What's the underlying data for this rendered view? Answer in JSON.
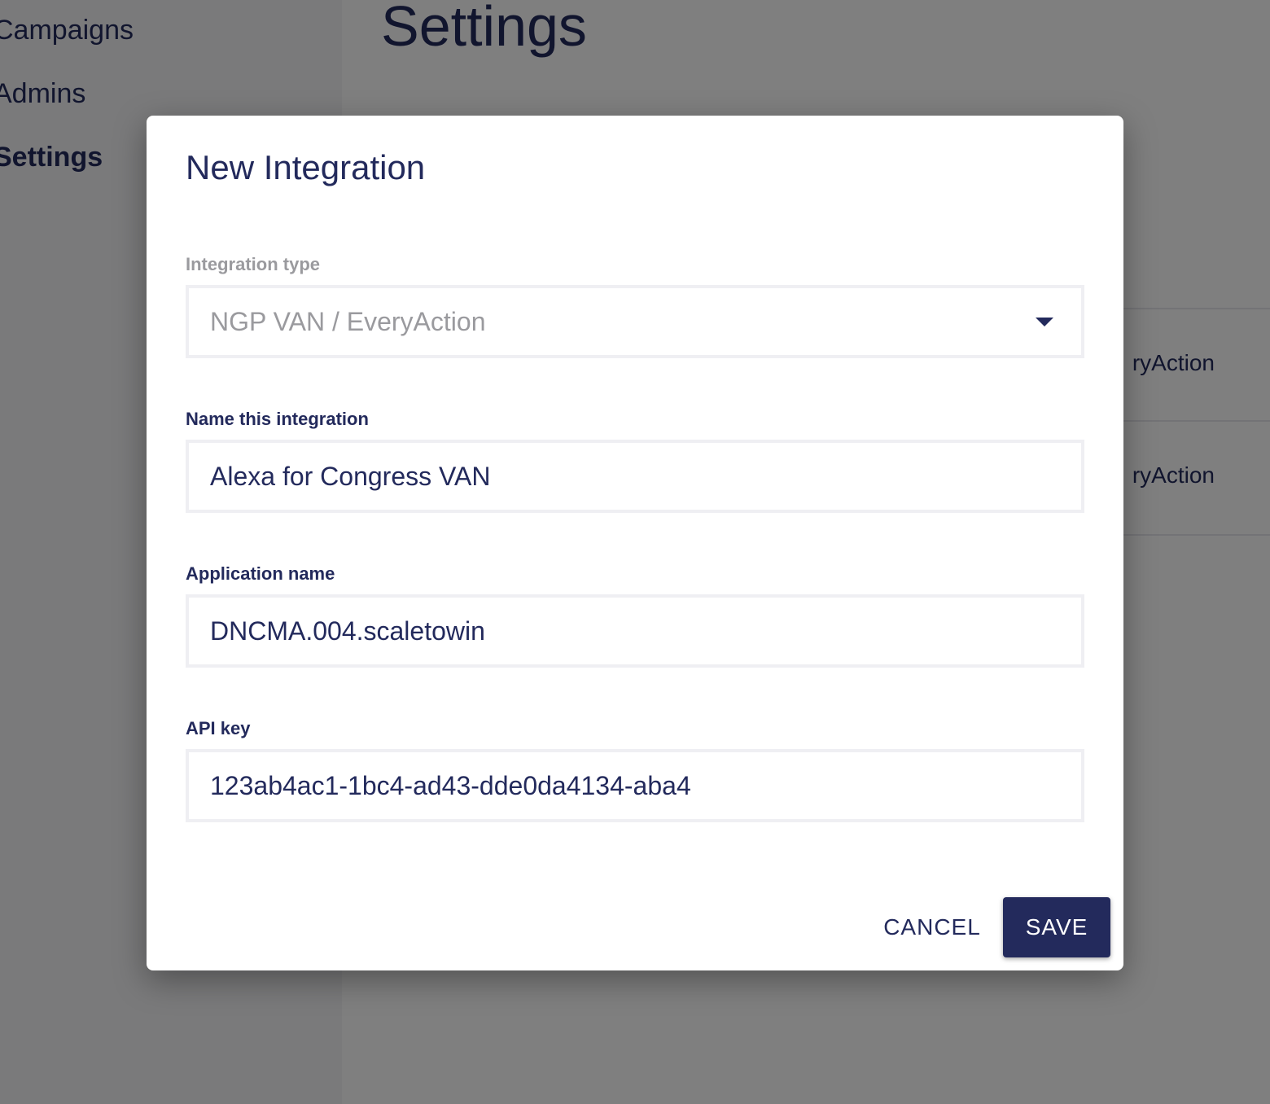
{
  "sidebar": {
    "items": [
      {
        "label": "Campaigns"
      },
      {
        "label": "Admins"
      },
      {
        "label": "Settings"
      }
    ]
  },
  "main": {
    "title": "Settings",
    "rows": [
      {
        "text": "ryAction"
      },
      {
        "text": "ryAction"
      }
    ]
  },
  "dialog": {
    "title": "New Integration",
    "integration_type": {
      "label": "Integration type",
      "value": "NGP VAN / EveryAction"
    },
    "name": {
      "label": "Name this integration",
      "value": "Alexa for Congress VAN"
    },
    "app_name": {
      "label": "Application name",
      "value": "DNCMA.004.scaletowin"
    },
    "api_key": {
      "label": "API key",
      "value": "123ab4ac1-1bc4-ad43-dde0da4134-aba4"
    },
    "cancel_label": "CANCEL",
    "save_label": "SAVE"
  },
  "colors": {
    "primary": "#232a5c",
    "overlay": "rgba(0,0,0,0.5)",
    "field_border": "#efeff3",
    "muted_text": "#9a9a9e"
  },
  "icons": {
    "select_caret": "chevron-down-icon"
  }
}
